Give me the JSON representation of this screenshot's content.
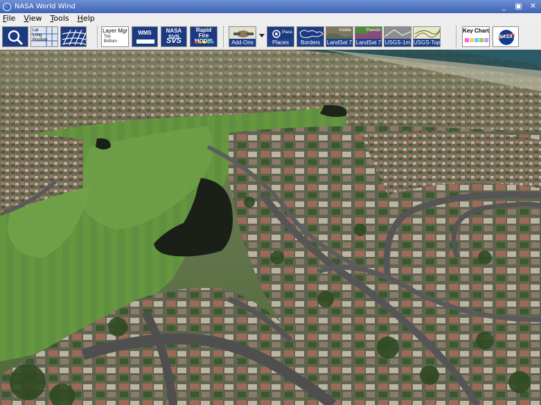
{
  "window": {
    "title": "NASA World Wind",
    "min_label": "_",
    "max_label": "▣",
    "close_label": "✕"
  },
  "menu": [
    {
      "label": "File"
    },
    {
      "label": "View"
    },
    {
      "label": "Tools"
    },
    {
      "label": "Help"
    }
  ],
  "toolbar": {
    "position": {
      "line1": "Lat",
      "line2": "Long",
      "line3": "Position"
    },
    "layer_mgr": {
      "label": "Layer Mgr",
      "opt1": "Top",
      "opt2": "Bottom"
    },
    "wms": {
      "label": "WMS"
    },
    "nasa_svs": {
      "label": "NASA SVS",
      "logo": "SVS"
    },
    "rapid_fire": {
      "line1": "Rapid Fire",
      "line2": "MODIS"
    },
    "addons": {
      "label": "Add-Ons"
    },
    "places": {
      "label": "Places",
      "sub": "Place"
    },
    "borders": {
      "label": "Borders"
    },
    "landsat_visible": {
      "label": "LandSat 7",
      "sub": "Visible"
    },
    "landsat_pseudo": {
      "label": "LandSat 7",
      "sub": "Pseudo"
    },
    "usgs_1m": {
      "label": "USGS-1m"
    },
    "usgs_topo": {
      "label": "USGS-Topo"
    },
    "key_chart": {
      "label": "Key Chart"
    },
    "nasa": {
      "label": "NASA"
    }
  },
  "colors": {
    "titlebar": "#4a6fc0",
    "toolbar_caption": "#1e3f8a",
    "grass": "#5f8f3a",
    "road": "#5a5a5a"
  }
}
